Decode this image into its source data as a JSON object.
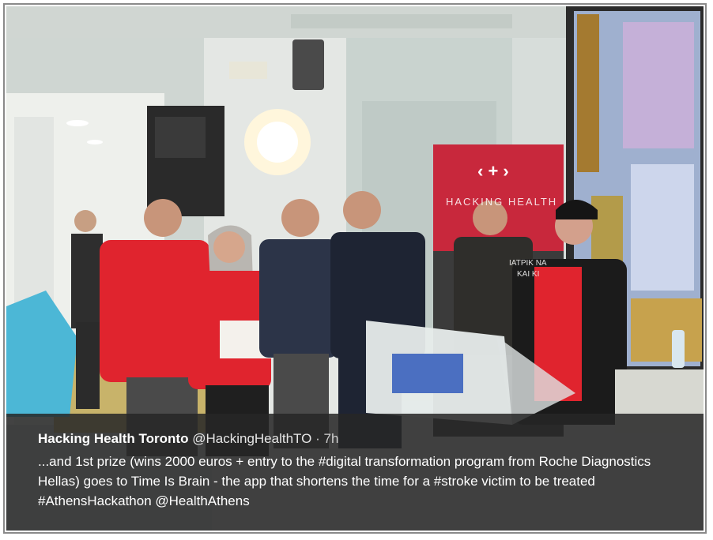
{
  "tweet": {
    "author_name": "Hacking Health Toronto",
    "handle": "@HackingHealthTO",
    "separator": "·",
    "time": "7h",
    "text_part1": "...and 1st prize (wins 2000 euros + entry to the ",
    "hashtag_digital": "#digital",
    "text_part2": " transformation program from Roche Diagnostics Hellas) goes to Time Is Brain - the app that shortens the time for a ",
    "hashtag_stroke": "#stroke",
    "text_part3": " victim to be treated ",
    "hashtag_athens": "#AthensHackathon",
    "text_part4": " ",
    "mention_health": "@HealthAthens"
  },
  "banner": {
    "logo_symbol": "‹ + ›",
    "title": "HACKING HEALTH",
    "subtitle_line1": "ΙΑΤΡΙΚ ΝΑ",
    "subtitle_line2": "ΚΑΙ ΚΙ"
  },
  "colors": {
    "caption_bg": "#262626",
    "banner_red": "#c8283c",
    "shirt_red": "#e0242e",
    "wall": "#d9dedb"
  }
}
